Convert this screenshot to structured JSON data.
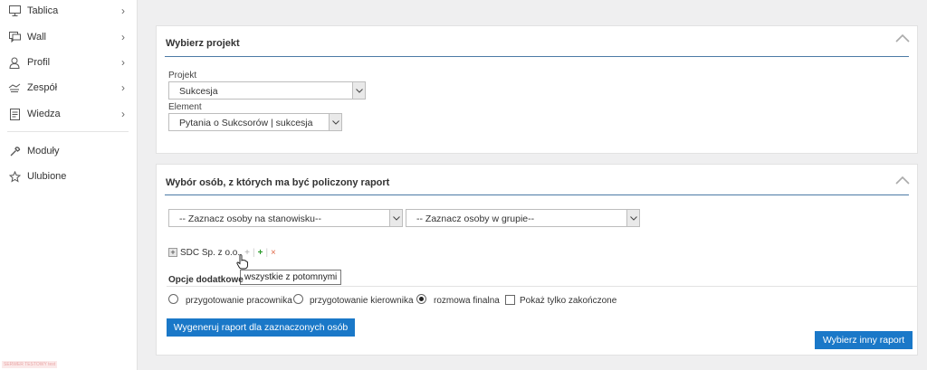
{
  "sidebar": {
    "items": [
      {
        "label": "Tablica",
        "icon": "monitor-icon",
        "chevron": "›"
      },
      {
        "label": "Wall",
        "icon": "chat-icon",
        "chevron": "›"
      },
      {
        "label": "Profil",
        "icon": "user-icon",
        "chevron": "›"
      },
      {
        "label": "Zespół",
        "icon": "team-icon",
        "chevron": "›"
      },
      {
        "label": "Wiedza",
        "icon": "document-icon",
        "chevron": "›"
      },
      {
        "label": "Moduły",
        "icon": "wrench-icon"
      },
      {
        "label": "Ulubione",
        "icon": "star-icon"
      }
    ],
    "server_tag": "SERWER TESTOWY test"
  },
  "project_panel": {
    "title": "Wybierz projekt",
    "project_label": "Projekt",
    "project_value": "Sukcesja",
    "element_label": "Element",
    "element_value": "Pytania o Sukcsorów | sukcesja"
  },
  "report_panel": {
    "title": "Wybór osób, z których ma być policzony raport",
    "position_select": "-- Zaznacz osoby na stanowisku--",
    "group_select": "-- Zaznacz osoby w grupie--",
    "tree_toggle": "+",
    "tree_node": "SDC Sp. z o.o.",
    "tree_actions": [
      "+",
      "|",
      "+",
      "|",
      "×"
    ],
    "tooltip": "wszystkie z potomnymi",
    "options_title": "Opcje dodatkowe",
    "options": [
      {
        "label": "przygotowanie pracownika",
        "type": "radio",
        "checked": false
      },
      {
        "label": "przygotowanie kierownika",
        "type": "radio",
        "checked": false
      },
      {
        "label": "rozmowa finalna",
        "type": "radio",
        "checked": true
      },
      {
        "label": "Pokaż tylko zakończone",
        "type": "checkbox",
        "checked": false
      }
    ],
    "generate_button": "Wygeneruj raport dla zaznaczonych osób",
    "other_report_button": "Wybierz inny raport"
  },
  "colors": {
    "accent": "#1a78c8",
    "panel_line": "#4c7aa6"
  }
}
